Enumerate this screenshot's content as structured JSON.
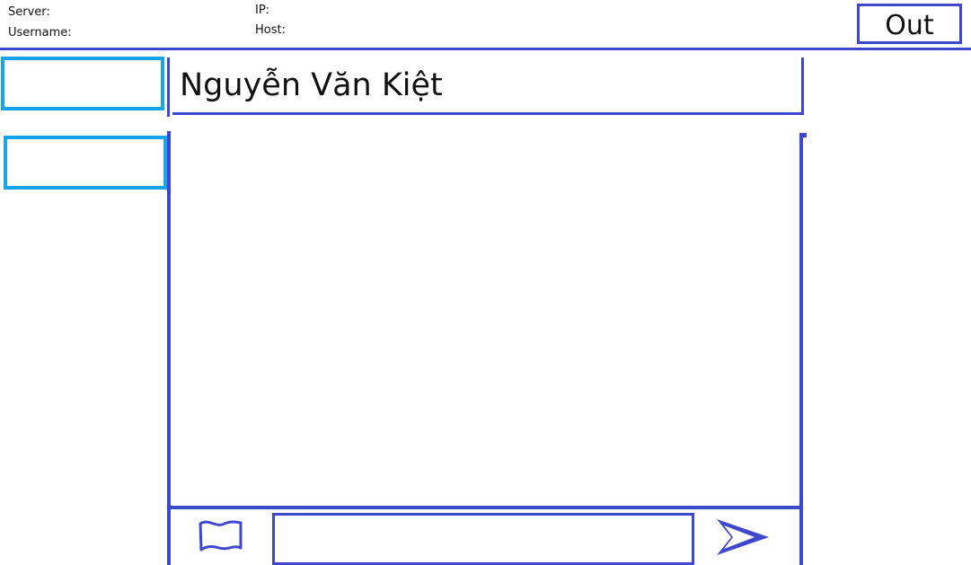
{
  "header": {
    "server_label": "Server:",
    "ip_label": "IP:",
    "username_label": "Username:",
    "host_label": "Host:",
    "out_label": "Out"
  },
  "chat": {
    "recipient_name": "Nguyễn Văn Kiệt"
  },
  "compose": {
    "message_value": "",
    "emoji_icon": "flag-icon",
    "send_icon": "send-arrow-icon"
  },
  "colors": {
    "accent": "#3f48cc",
    "contact_border": "#19a3e8",
    "background": "#ffffff"
  }
}
